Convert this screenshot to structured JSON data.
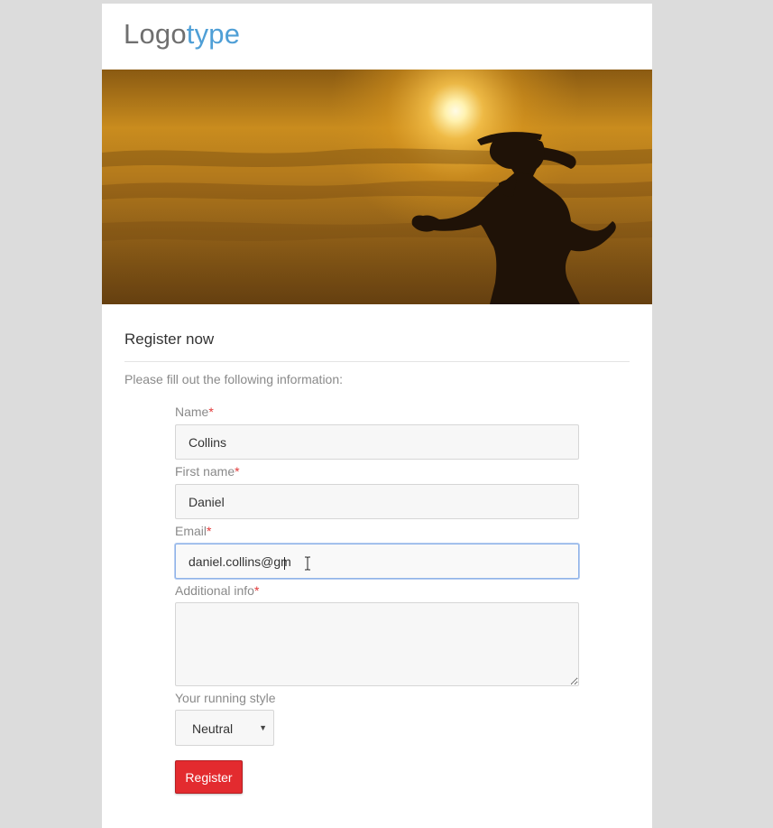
{
  "logo": {
    "part1": "Logo",
    "part2": "type"
  },
  "hero": {
    "image": "runner-silhouette-at-sunset"
  },
  "form": {
    "heading": "Register now",
    "intro": "Please fill out the following information:",
    "required_mark": "*",
    "fields": {
      "name": {
        "label": "Name",
        "value": "Collins"
      },
      "first_name": {
        "label": "First name",
        "value": "Daniel"
      },
      "email": {
        "label": "Email",
        "value": "daniel.collins@gm"
      },
      "additional_info": {
        "label": "Additional info",
        "value": ""
      }
    },
    "running_style": {
      "label": "Your running style",
      "selected": "Neutral"
    },
    "submit_label": "Register"
  },
  "colors": {
    "page_background": "#dcdcdc",
    "logo_dark": "#6f6f6f",
    "logo_accent": "#4f9fd6",
    "required": "#e23a3a",
    "button": "#e32b2f",
    "focus_border": "#8fb3e9"
  }
}
